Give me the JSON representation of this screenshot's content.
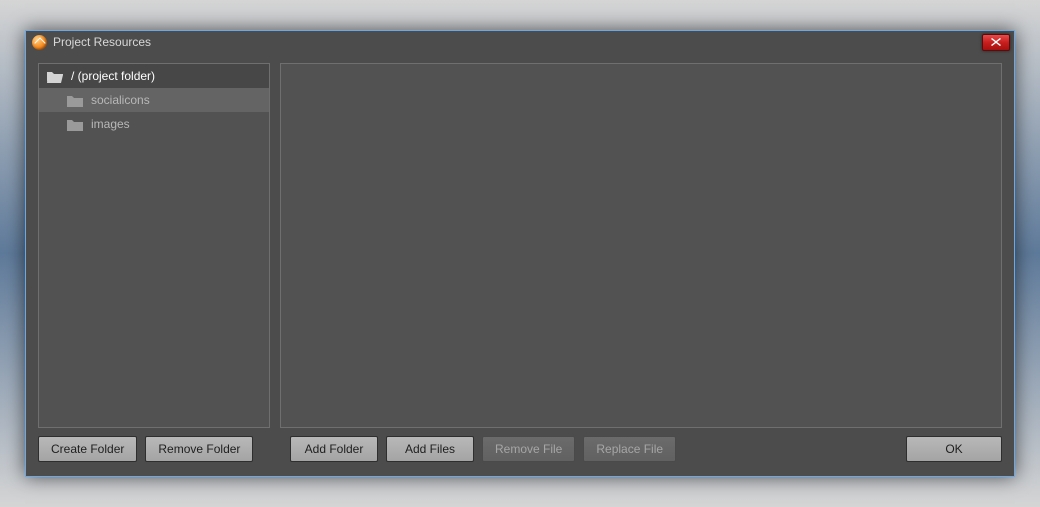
{
  "window": {
    "title": "Project Resources"
  },
  "tree": {
    "root_label": "/ (project folder)",
    "items": [
      {
        "label": "socialicons"
      },
      {
        "label": "images"
      }
    ],
    "selected_index": 0
  },
  "buttons": {
    "create_folder": "Create Folder",
    "remove_folder": "Remove Folder",
    "add_folder": "Add Folder",
    "add_files": "Add Files",
    "remove_file": "Remove File",
    "replace_file": "Replace File",
    "ok": "OK"
  }
}
